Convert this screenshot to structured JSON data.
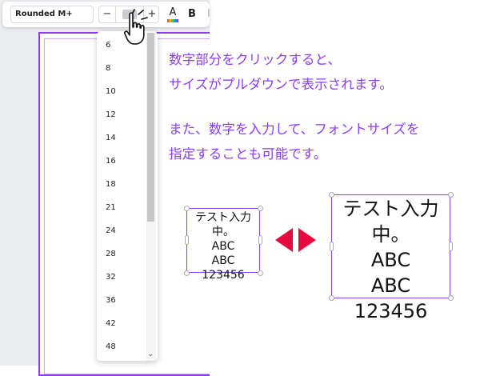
{
  "toolbar": {
    "font_name": "Rounded M+",
    "minus_label": "−",
    "plus_label": "+",
    "text_color_label": "A",
    "bold_label": "B",
    "italic_label": "I"
  },
  "dropdown": {
    "sizes": [
      "6",
      "8",
      "10",
      "12",
      "14",
      "16",
      "18",
      "21",
      "24",
      "28",
      "32",
      "36",
      "42",
      "48"
    ]
  },
  "instructions": {
    "line1": "数字部分をクリックすると、",
    "line2": "サイズがプルダウンで表示されます。",
    "line3": "また、数字を入力して、フォントサイズを",
    "line4": "指定することも可能です。"
  },
  "samples": {
    "small": {
      "line1": "テスト入力中。",
      "line2": "ABC",
      "line3": "ABC",
      "line4": "123456"
    },
    "large": {
      "line1": "テスト入力中。",
      "line2": "ABC",
      "line3": "ABC",
      "line4": "123456"
    }
  },
  "colors": {
    "accent": "#8b3dff",
    "arrow": "#e8083e"
  }
}
